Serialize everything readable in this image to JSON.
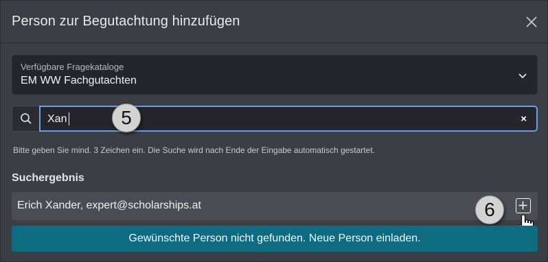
{
  "dialog": {
    "title": "Person zur Begutachtung hinzufügen",
    "close_icon": "close-icon"
  },
  "catalog_select": {
    "label": "Verfügbare Fragekataloge",
    "value": "EM WW Fachgutachten",
    "icon": "chevron-down-icon"
  },
  "search": {
    "icon": "search-icon",
    "value": "Xan",
    "clear_label": "×"
  },
  "hint": "Bitte geben Sie mind. 3 Zeichen ein. Die Suche wird nach Ende der Eingabe automatisch gestartet.",
  "results": {
    "title": "Suchergebnis",
    "items": [
      {
        "text": "Erich Xander, expert@scholarships.at",
        "action_icon": "plus-icon"
      }
    ]
  },
  "invite_button": "Gewünschte Person nicht gefunden. Neue Person einladen.",
  "annotations": {
    "step_5": "5",
    "step_6": "6"
  },
  "colors": {
    "dialog_bg": "#3b3e45",
    "input_bg": "#24262b",
    "focus_border": "#6f9fe0",
    "result_bg": "#4a4d54",
    "invite_bg": "#0f6b82"
  }
}
